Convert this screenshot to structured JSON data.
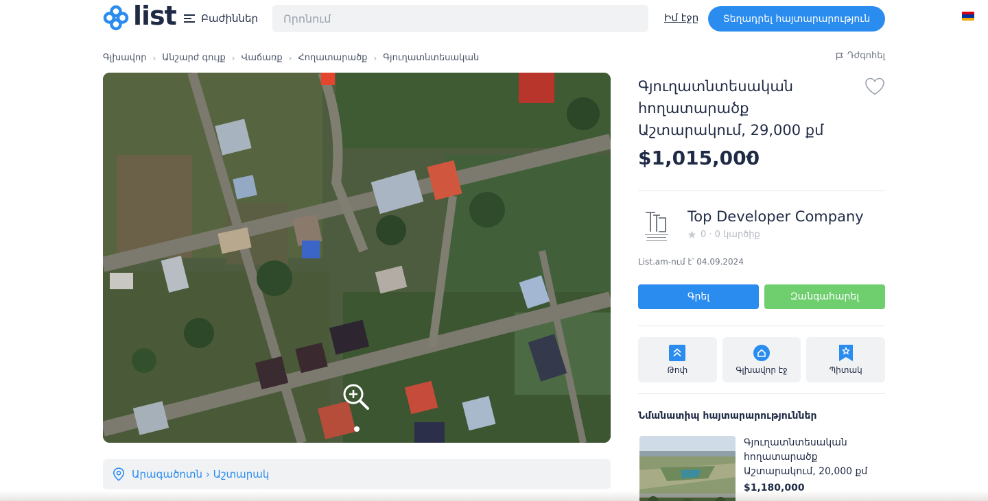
{
  "header": {
    "logo_text": "list",
    "menu_label": "Բաժիններ",
    "search_placeholder": "Որոնում",
    "my_page": "Իմ էջը",
    "post_button": "Տեղադրել հայտարարություն"
  },
  "breadcrumb": {
    "items": [
      "Գլխավոր",
      "Անշարժ գույք",
      "Վաճառք",
      "Հողատարածք",
      "Գյուղատնտեսական"
    ],
    "report": "Դժգոհել"
  },
  "gallery": {
    "slide_count": 1,
    "active_slide": 1
  },
  "location": {
    "text": "Արագածոտն › Աշտարակ"
  },
  "listing": {
    "title": "Գյուղատնտեսական հողատարածք Աշտարակում, 29,000 քմ",
    "price": "$1,015,000"
  },
  "seller": {
    "name": "Top Developer Company",
    "rating": "0 · 0 կարծիք",
    "since": "List.am-ում է՝ 04.09.2024",
    "write_button": "Գրել",
    "call_button": "Զանգահարել"
  },
  "tiles": [
    {
      "label": "Թոփ",
      "icon": "arrow-up-icon"
    },
    {
      "label": "Գլխավոր էջ",
      "icon": "home-icon"
    },
    {
      "label": "Պիտակ",
      "icon": "star-icon"
    }
  ],
  "similar": {
    "title": "Նմանատիպ հայտարարություններ",
    "items": [
      {
        "title": "Գյուղատնտեսական հողատարածք Աշտարակում, 20,000 քմ",
        "price": "$1,180,000"
      }
    ]
  },
  "colors": {
    "accent": "#2b8cf0",
    "call": "#6fcf6f",
    "text": "#1f2a44"
  }
}
